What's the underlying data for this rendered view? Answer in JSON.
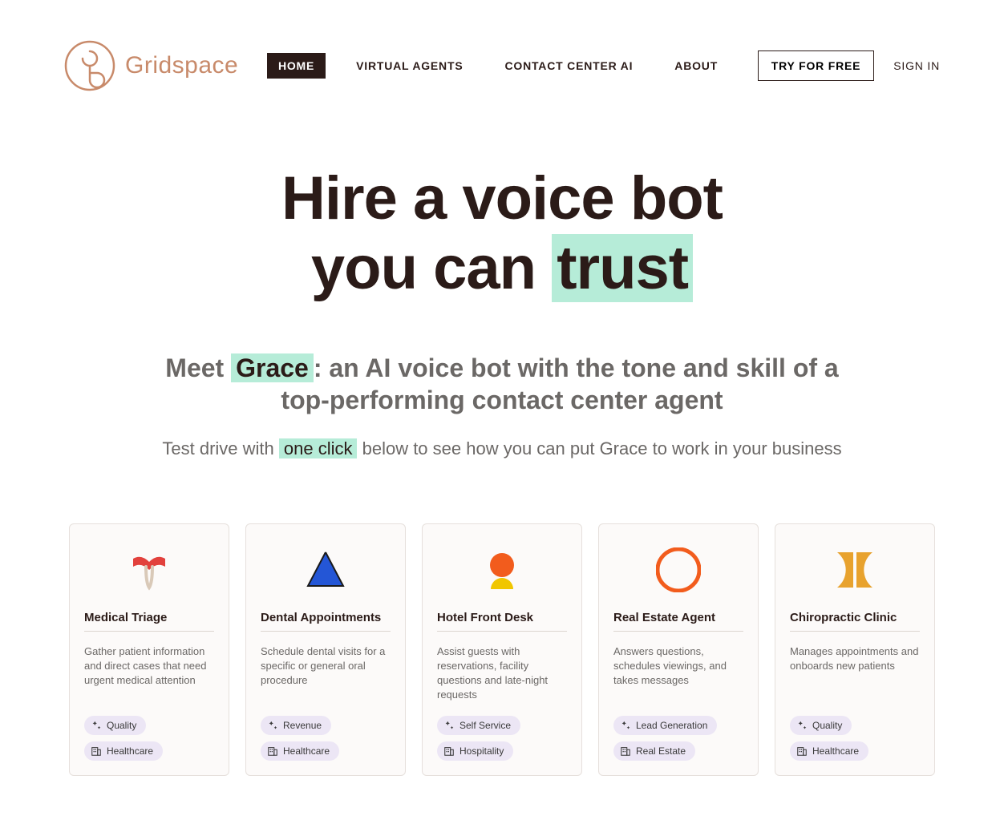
{
  "brand": {
    "name": "Gridspace"
  },
  "nav": {
    "items": [
      {
        "label": "HOME",
        "active": true
      },
      {
        "label": "VIRTUAL AGENTS",
        "active": false
      },
      {
        "label": "CONTACT CENTER AI",
        "active": false
      },
      {
        "label": "ABOUT",
        "active": false
      }
    ],
    "try_label": "TRY FOR FREE",
    "signin_label": "SIGN IN"
  },
  "hero": {
    "title_line1": "Hire a voice bot",
    "title_line2_pre": "you can ",
    "title_line2_hl": "trust",
    "sub_pre": "Meet ",
    "sub_hl": "Grace",
    "sub_post": ": an AI voice bot with the tone and skill of a top-performing contact center agent",
    "tag_pre": "Test drive with ",
    "tag_hl": "one click",
    "tag_post": " below to see how you can put Grace to work in your business"
  },
  "cards": [
    {
      "title": "Medical Triage",
      "desc": "Gather patient information and direct cases that need urgent medical attention",
      "tag1": "Quality",
      "tag2": "Healthcare",
      "icon": "medical"
    },
    {
      "title": "Dental Appointments",
      "desc": "Schedule dental visits for a specific or general oral procedure",
      "tag1": "Revenue",
      "tag2": "Healthcare",
      "icon": "dental"
    },
    {
      "title": "Hotel Front Desk",
      "desc": "Assist guests with reservations, facility questions and late-night requests",
      "tag1": "Self Service",
      "tag2": "Hospitality",
      "icon": "hotel"
    },
    {
      "title": "Real Estate Agent",
      "desc": "Answers questions, schedules viewings, and takes messages",
      "tag1": "Lead Generation",
      "tag2": "Real Estate",
      "icon": "realestate"
    },
    {
      "title": "Chiropractic Clinic",
      "desc": "Manages appointments and onboards new patients",
      "tag1": "Quality",
      "tag2": "Healthcare",
      "icon": "chiro"
    }
  ]
}
